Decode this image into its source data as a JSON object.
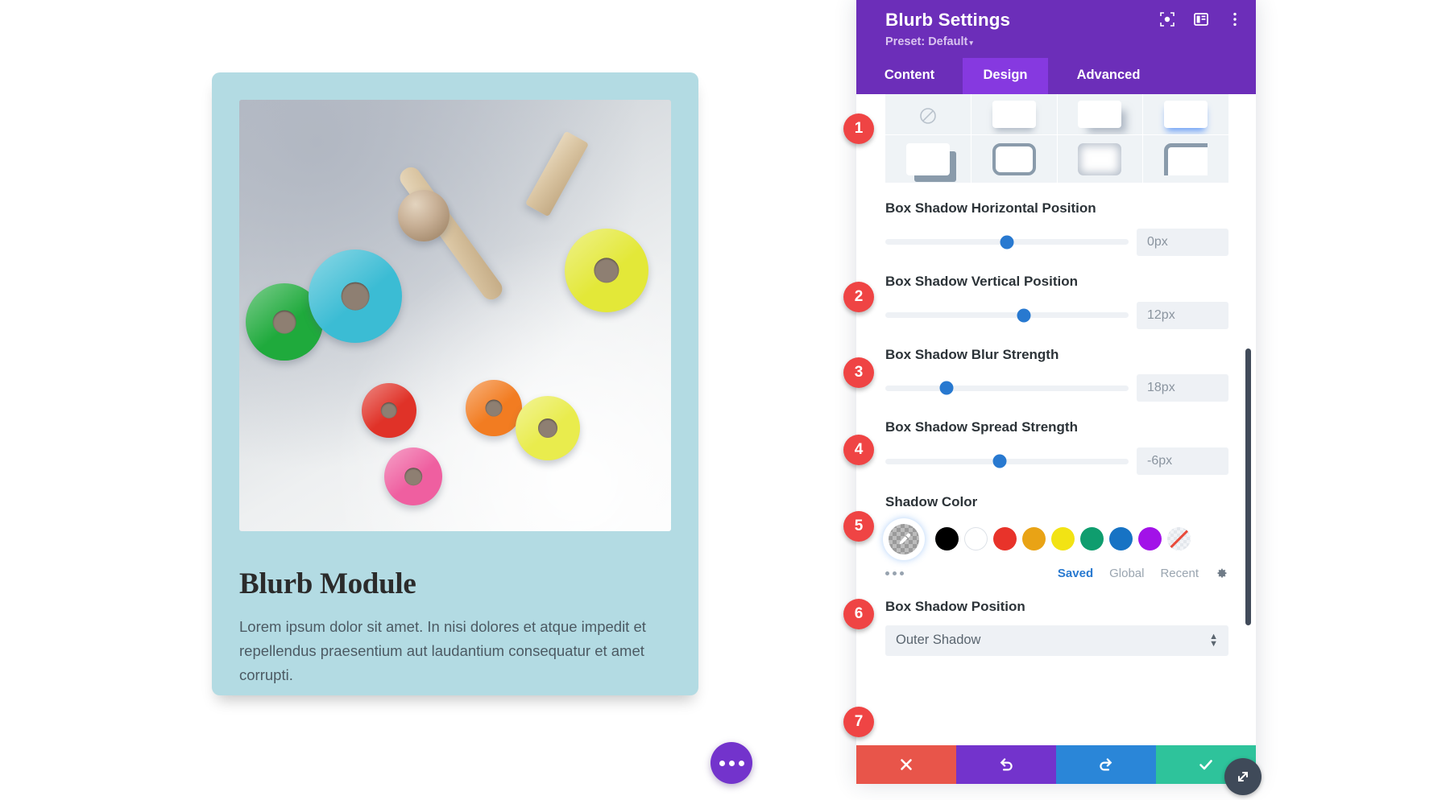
{
  "panel": {
    "title": "Blurb Settings",
    "preset_label": "Preset: Default",
    "preset_caret": "▾",
    "head_icons": [
      {
        "name": "focus-icon"
      },
      {
        "name": "layout-icon"
      },
      {
        "name": "more-vertical-icon"
      }
    ],
    "tabs": [
      {
        "label": "Content",
        "active": false
      },
      {
        "label": "Design",
        "active": true
      },
      {
        "label": "Advanced",
        "active": false
      }
    ],
    "shadow_presets": [
      {
        "name": "none",
        "label": "No Shadow"
      },
      {
        "name": "bottom-soft",
        "label": "Bottom Soft Shadow"
      },
      {
        "name": "offset-soft",
        "label": "Offset Soft Shadow"
      },
      {
        "name": "bottom-blue",
        "label": "Bottom Blue Shadow"
      },
      {
        "name": "hard-offset",
        "label": "Hard Offset Shadow"
      },
      {
        "name": "outline",
        "label": "Outline Shadow"
      },
      {
        "name": "inner",
        "label": "Inner Shadow"
      },
      {
        "name": "corner",
        "label": "Corner Shadow"
      }
    ],
    "controls": [
      {
        "label": "Box Shadow Horizontal Position",
        "value": "0px",
        "knob_percent": 50,
        "badge": "2"
      },
      {
        "label": "Box Shadow Vertical Position",
        "value": "12px",
        "knob_percent": 57,
        "badge": "3"
      },
      {
        "label": "Box Shadow Blur Strength",
        "value": "18px",
        "knob_percent": 25,
        "badge": "4"
      },
      {
        "label": "Box Shadow Spread Strength",
        "value": "-6px",
        "knob_percent": 47,
        "badge": "5"
      }
    ],
    "shadow_color": {
      "label": "Shadow Color",
      "badge": "6",
      "eyedropper": "eyedropper-icon",
      "swatches": [
        {
          "name": "black",
          "hex": "#000000"
        },
        {
          "name": "white",
          "hex": "#ffffff"
        },
        {
          "name": "red",
          "hex": "#e8332a"
        },
        {
          "name": "orange",
          "hex": "#e9a315"
        },
        {
          "name": "yellow",
          "hex": "#f2e314"
        },
        {
          "name": "green",
          "hex": "#0f9d6e"
        },
        {
          "name": "blue",
          "hex": "#1773c4"
        },
        {
          "name": "purple",
          "hex": "#a212e8"
        },
        {
          "name": "none",
          "hex": "transparent"
        }
      ],
      "more_dots": "more-horizontal-icon",
      "source_tabs": [
        {
          "label": "Saved",
          "active": true
        },
        {
          "label": "Global",
          "active": false
        },
        {
          "label": "Recent",
          "active": false
        }
      ],
      "settings_icon": "gear-icon"
    },
    "position_select": {
      "label": "Box Shadow Position",
      "value": "Outer Shadow",
      "badge": "7"
    },
    "footer_buttons": [
      {
        "name": "cancel-button",
        "icon": "close-icon"
      },
      {
        "name": "undo-button",
        "icon": "undo-icon"
      },
      {
        "name": "redo-button",
        "icon": "redo-icon"
      },
      {
        "name": "save-button",
        "icon": "check-icon"
      }
    ],
    "resize_handle": "resize-icon",
    "badge_presets": "1"
  },
  "canvas": {
    "blurb": {
      "title": "Blurb Module",
      "body": "Lorem ipsum dolor sit amet. In nisi dolores et atque impedit et repellendus praesentium aut laudantium consequatur et amet corrupti.",
      "image_alt": "wooden-toy-rings-photo",
      "card_bg": "#b3dbe3"
    },
    "fab": "more-options-button"
  },
  "colors": {
    "brand_purple": "#6c2eb9",
    "tab_active": "#8639e0",
    "accent_blue": "#2879d0",
    "badge_red": "#ef4444",
    "save_green": "#2ec39b",
    "cancel_red": "#e8554a",
    "redo_blue": "#2a86d8"
  }
}
